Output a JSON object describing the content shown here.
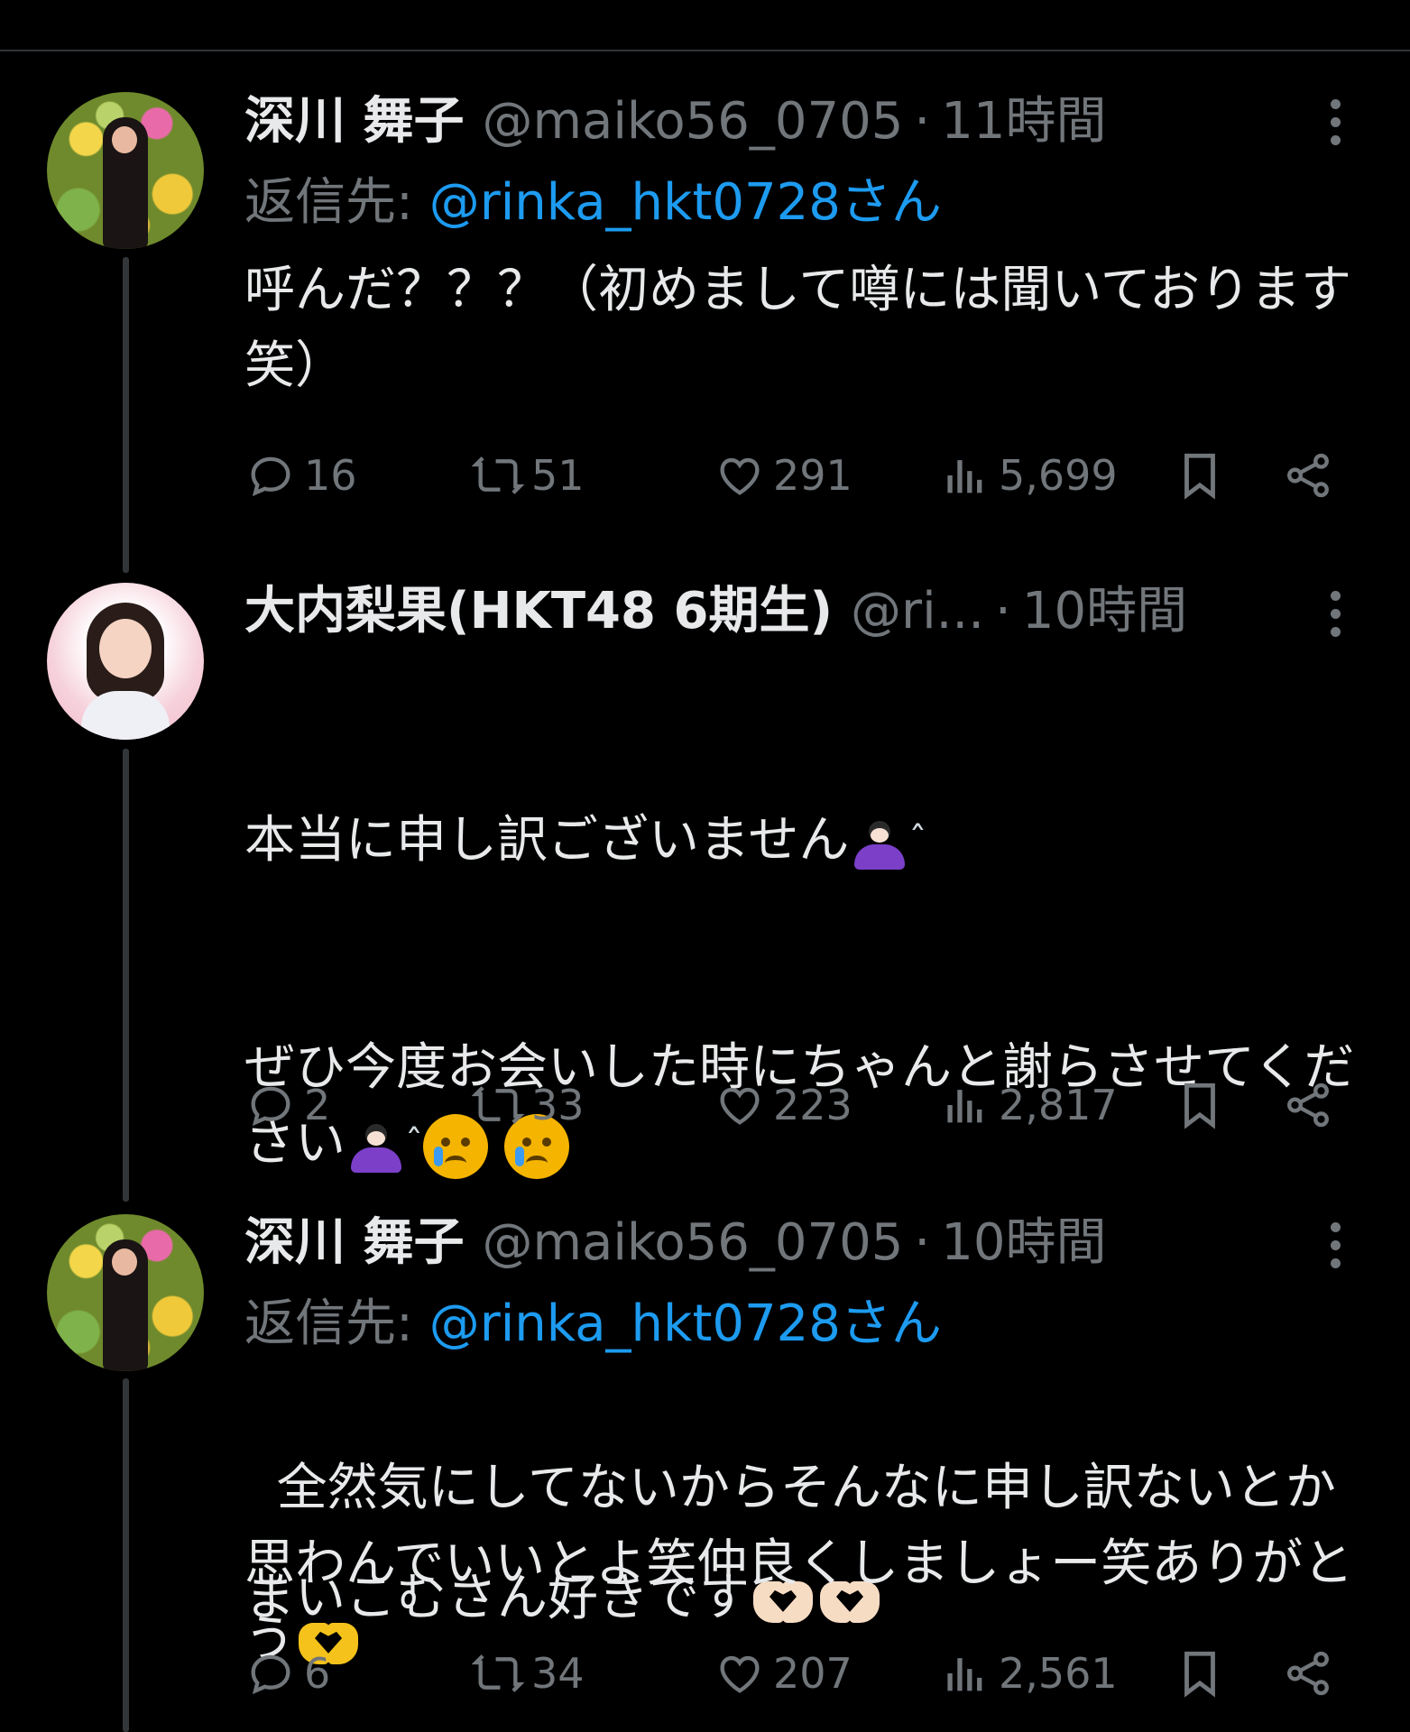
{
  "tweets": [
    {
      "name": "深川 舞子",
      "handle": "@maiko56_0705",
      "dot": "·",
      "time": "11時間",
      "reply_label": "返信先:",
      "reply_mention": "@rinka_hkt0728さん",
      "text": "呼んだ？？？（初めまして噂には聞いております笑）",
      "replies": "16",
      "retweets": "51",
      "likes": "291",
      "views": "5,699"
    },
    {
      "name": "大内梨果(HKT48 6期生)",
      "handle": "@ri...",
      "dot": "·",
      "time": "10時間",
      "line1": "本当に申し訳ございません",
      "line2": "ぜひ今度お会いした時にちゃんと謝らさせてください",
      "line3": "まいこむさん好きです",
      "replies": "2",
      "retweets": "33",
      "likes": "223",
      "views": "2,817"
    },
    {
      "name": "深川 舞子",
      "handle": "@maiko56_0705",
      "dot": "·",
      "time": "10時間",
      "reply_label": "返信先:",
      "reply_mention": "@rinka_hkt0728さん",
      "text": "全然気にしてないからそんなに申し訳ないとか思わんでいいとよ笑仲良くしましょー笑ありがとう",
      "replies": "6",
      "retweets": "34",
      "likes": "207",
      "views": "2,561"
    }
  ],
  "emoji": {
    "sweat": "ˆ"
  },
  "colors": {
    "background": "#000000",
    "text": "#e7e9ea",
    "muted": "#71767b",
    "link": "#1d9bf0",
    "divider": "#2f3336"
  },
  "icons": [
    "more-icon",
    "reply-icon",
    "retweet-icon",
    "like-icon",
    "views-icon",
    "bookmark-icon",
    "share-icon"
  ]
}
